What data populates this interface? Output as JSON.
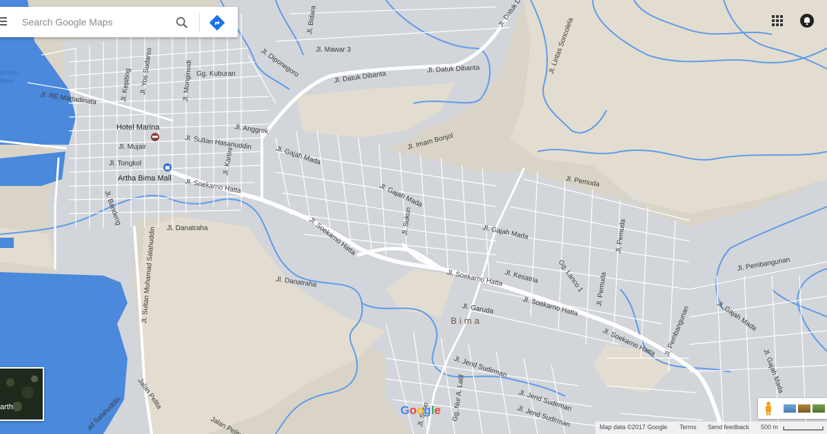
{
  "search": {
    "placeholder": "Search Google Maps"
  },
  "map": {
    "city_label": "Bima",
    "water_labels": [
      "abuhan",
      "Bima"
    ],
    "place_labels": [
      {
        "name": "Hotel Marina",
        "icon": "hotel-icon"
      },
      {
        "name": "Artha Bima Mall",
        "icon": "shopping-icon"
      }
    ],
    "street_labels": [
      "Jl. Bidara",
      "Jl. Mawar 3",
      "Jl. Datuk Dibanta",
      "Jl. Datuk Dibanta",
      "Jl. Datuk Dibanta",
      "Jl. Diponegoro",
      "Jl. Lintas Soncolela",
      "Jl. Kepiting",
      "Jl. Yos Sudarso",
      "Jl. Monginsidi",
      "Gg. Kuburan",
      "Jl. RE Martadinata",
      "Jl. Anggrek",
      "Jl. Sultan Hasanuddin",
      "Jl. Mujair",
      "Jl. Tongkol",
      "Jl. Kartini",
      "Jl. Gajah Mada",
      "Jl. Imam Bonjol",
      "Jl. Soekarno Hatta",
      "Jl. Bandeng",
      "Jl. Sultan Muhamad Salahuddin",
      "Jl. Danatraha",
      "Jl. Gajah Mada",
      "Jl. Sukun",
      "Jl. Soekarno Hatta",
      "Jl. Pemuda",
      "Jl. Pemuda",
      "Jl. Gajah Mada",
      "Jl. Pembangunan",
      "Jl. Danatraha",
      "Jl. Kesatria",
      "Gg. Lanco 1",
      "Jl. Soekarno Hatta",
      "Jl. Soekarno Hatta",
      "Jl. Pemuda",
      "Jl. Garuda",
      "Jl. Pembangunan",
      "Jl. Gajah Mada",
      "Jl. Soekarno Hatta",
      "Jl. Gajah Mada",
      "Jl. Jend Sudirman",
      "Jl. Jend Sudirman",
      "Jl. Jend Sudirman",
      "Gg. Nur A. Latif",
      "Jl. Subo",
      "Jalan Pelita",
      "Jalan Pelita",
      "ad Salahuddin"
    ]
  },
  "earth": {
    "label": "arth"
  },
  "logo": {
    "text": "Google"
  },
  "footer": {
    "map_data": "Map data ©2017 Google",
    "terms": "Terms",
    "feedback": "Send feedback",
    "scale": "500 m"
  },
  "colors": {
    "water": "#4a89dc",
    "land": "#d9d4c7",
    "urban": "#d3d6db",
    "road": "#ffffff",
    "river": "#5d9be8"
  }
}
